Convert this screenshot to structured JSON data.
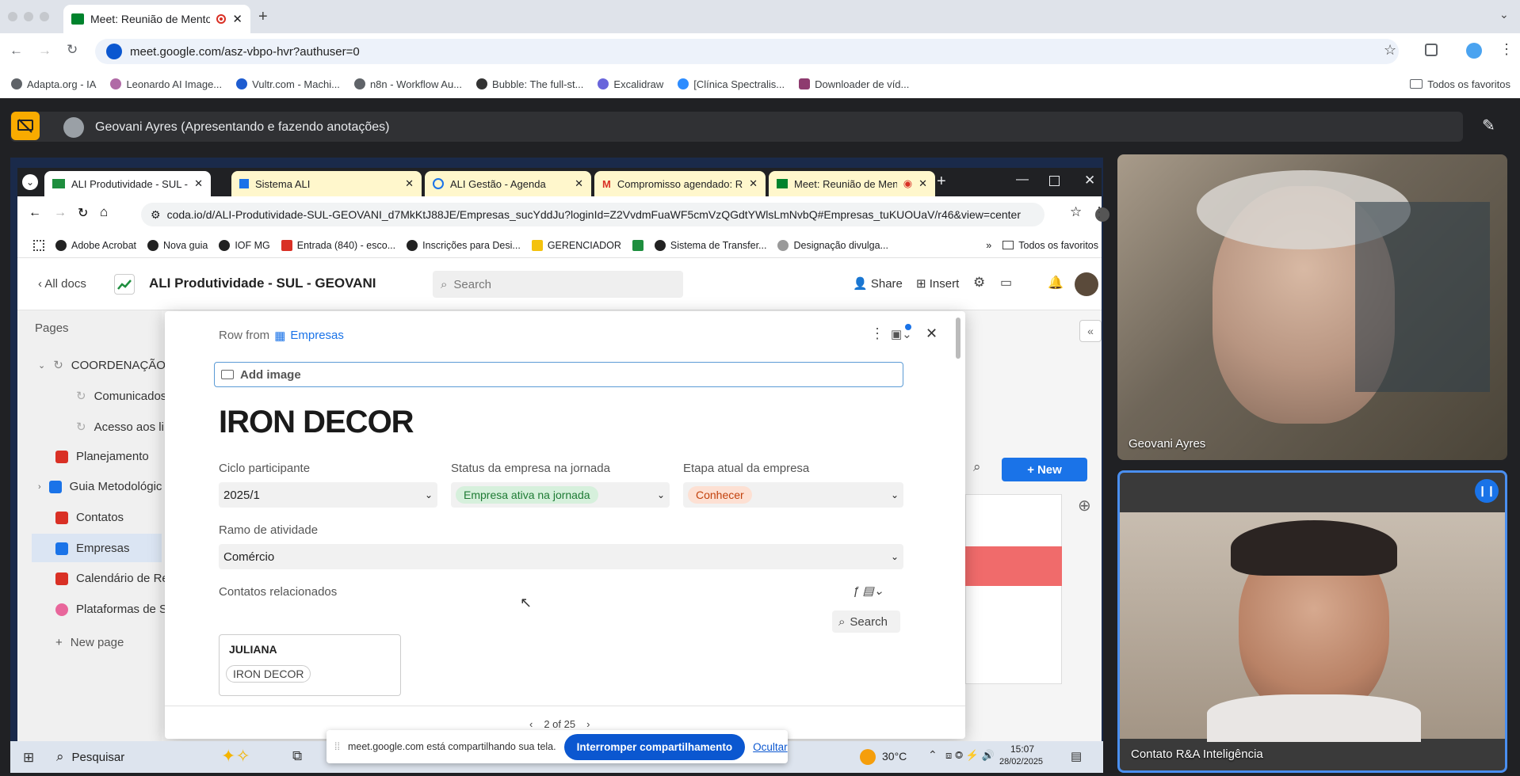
{
  "outer_browser": {
    "tab_title": "Meet: Reunião de Mentoria",
    "url": "meet.google.com/asz-vbpo-hvr?authuser=0",
    "bookmarks": [
      "Adapta.org - IA",
      "Leonardo AI Image...",
      "Vultr.com - Machi...",
      "n8n - Workflow Au...",
      "Bubble: The full-st...",
      "Excalidraw",
      "[Clínica Spectralis...",
      "Downloader de víd..."
    ],
    "all_bookmarks": "Todos os favoritos"
  },
  "meet": {
    "presenter_label": "Geovani Ayres (Apresentando e fazendo anotações)",
    "participants": [
      {
        "name": "Geovani Ayres"
      },
      {
        "name": "Contato R&A Inteligência"
      }
    ],
    "share_notice": "meet.google.com está compartilhando sua tela.",
    "stop_share": "Interromper compartilhamento",
    "hide": "Ocultar"
  },
  "inner_browser": {
    "tabs": [
      {
        "title": "ALI Produtividade - SUL - GEOVANI"
      },
      {
        "title": "Sistema ALI"
      },
      {
        "title": "ALI Gestão - Agenda"
      },
      {
        "title": "Compromisso agendado: Re"
      },
      {
        "title": "Meet: Reunião de Mentoria"
      }
    ],
    "url": "coda.io/d/ALI-Produtividade-SUL-GEOVANI_d7MkKtJ88JE/Empresas_sucYddJu?loginId=Z2VvdmFuaWF5cmVzQGdtYWlsLmNvbQ#Empresas_tuKUOUaV/r46&view=center",
    "bookmarks": [
      "Adobe Acrobat",
      "Nova guia",
      "IOF MG",
      "Entrada (840) - esco...",
      "Inscrições para Desi...",
      "GERENCIADOR",
      "Sistema de Transfer...",
      "Designação divulga..."
    ],
    "all_bookmarks": "Todos os favoritos"
  },
  "coda": {
    "back": "All docs",
    "doc_title": "ALI Produtividade - SUL - GEOVANI",
    "search_placeholder": "Search",
    "share": "Share",
    "insert": "Insert",
    "pages_label": "Pages",
    "sidebar": [
      {
        "label": "COORDENAÇÃO",
        "color": "#888"
      },
      {
        "label": "Comunicados",
        "color": "#999"
      },
      {
        "label": "Acesso aos li",
        "color": "#999"
      },
      {
        "label": "Planejamento",
        "color": "#d93025"
      },
      {
        "label": "Guia Metodológic",
        "color": "#1a73e8"
      },
      {
        "label": "Contatos",
        "color": "#d93025"
      },
      {
        "label": "Empresas",
        "color": "#1a73e8"
      },
      {
        "label": "Calendário de Re",
        "color": "#d93025"
      },
      {
        "label": "Plataformas de S",
        "color": "#e8669b"
      }
    ],
    "new_page": "New page",
    "new_button": "New"
  },
  "modal": {
    "row_from": "Row from",
    "table_name": "Empresas",
    "add_image": "Add image",
    "title": "IRON DECOR",
    "fields": {
      "ciclo_label": "Ciclo participante",
      "ciclo_value": "2025/1",
      "status_label": "Status da empresa na jornada",
      "status_value": "Empresa ativa na jornada",
      "etapa_label": "Etapa atual da empresa",
      "etapa_value": "Conhecer",
      "ramo_label": "Ramo de atividade",
      "ramo_value": "Comércio",
      "contatos_label": "Contatos relacionados"
    },
    "contact_card": {
      "name": "JULIANA",
      "company": "IRON DECOR"
    },
    "search": "Search",
    "pagination": "2 of 25"
  },
  "taskbar": {
    "search": "Pesquisar",
    "temperature": "30°C",
    "time": "15:07",
    "date": "28/02/2025"
  },
  "colors": {
    "status_green_bg": "#d6f0dc",
    "status_green_text": "#1e7b34",
    "etapa_orange_bg": "#fde0d3",
    "etapa_orange_text": "#c2410c",
    "accent_blue": "#1a73e8"
  }
}
